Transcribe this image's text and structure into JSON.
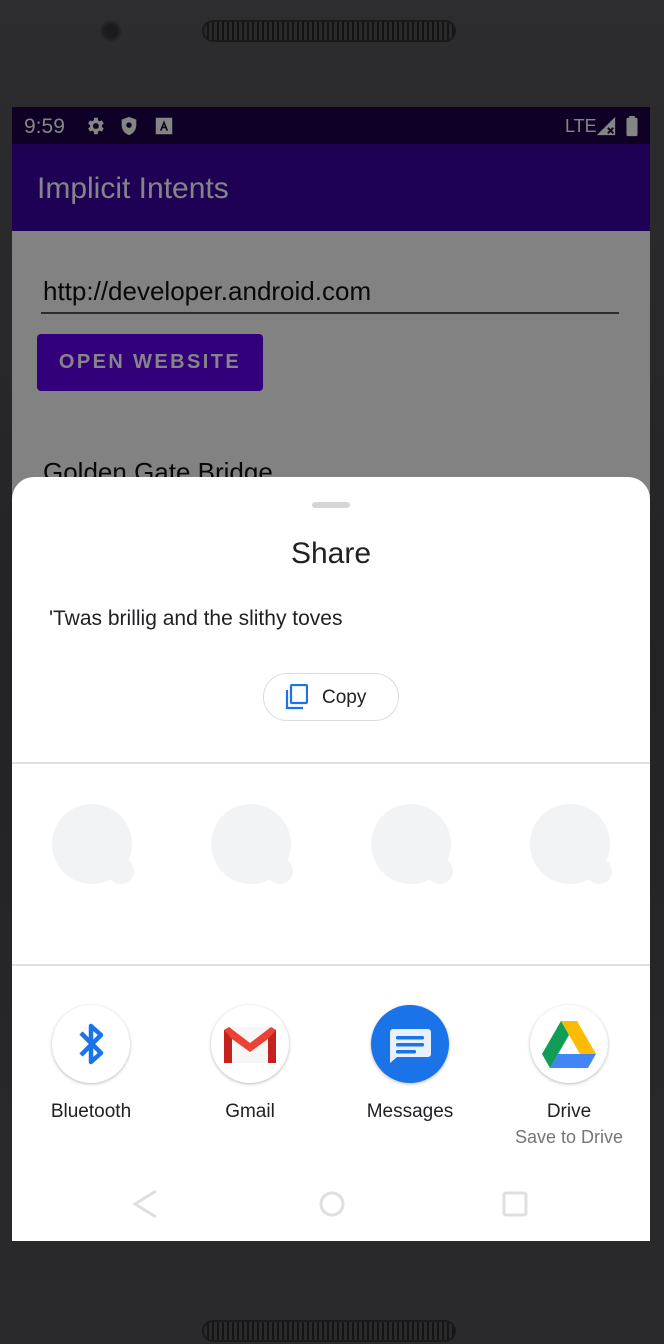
{
  "status_bar": {
    "time": "9:59",
    "network": "LTE",
    "icons": [
      "gear-icon",
      "shield-icon",
      "a-box-icon",
      "signal-icon",
      "battery-icon"
    ]
  },
  "app": {
    "title": "Implicit Intents",
    "url_field_value": "http://developer.android.com",
    "open_website_label": "OPEN WEBSITE",
    "location_field_value": "Golden Gate Bridge"
  },
  "share_sheet": {
    "title": "Share",
    "preview_text": "'Twas brillig and the slithy toves",
    "copy_label": "Copy",
    "placeholder_count": 4,
    "targets": [
      {
        "label": "Bluetooth",
        "sublabel": "",
        "icon": "bluetooth-icon"
      },
      {
        "label": "Gmail",
        "sublabel": "",
        "icon": "gmail-icon"
      },
      {
        "label": "Messages",
        "sublabel": "",
        "icon": "messages-icon"
      },
      {
        "label": "Drive",
        "sublabel": "Save to Drive",
        "icon": "drive-icon"
      }
    ]
  },
  "colors": {
    "status_bar": "#1b0247",
    "app_bar": "#3b00a3",
    "primary_button": "#6200ee",
    "bluetooth": "#1a73e8",
    "gmail_red": "#ea4335",
    "messages_blue": "#1a73e8"
  }
}
